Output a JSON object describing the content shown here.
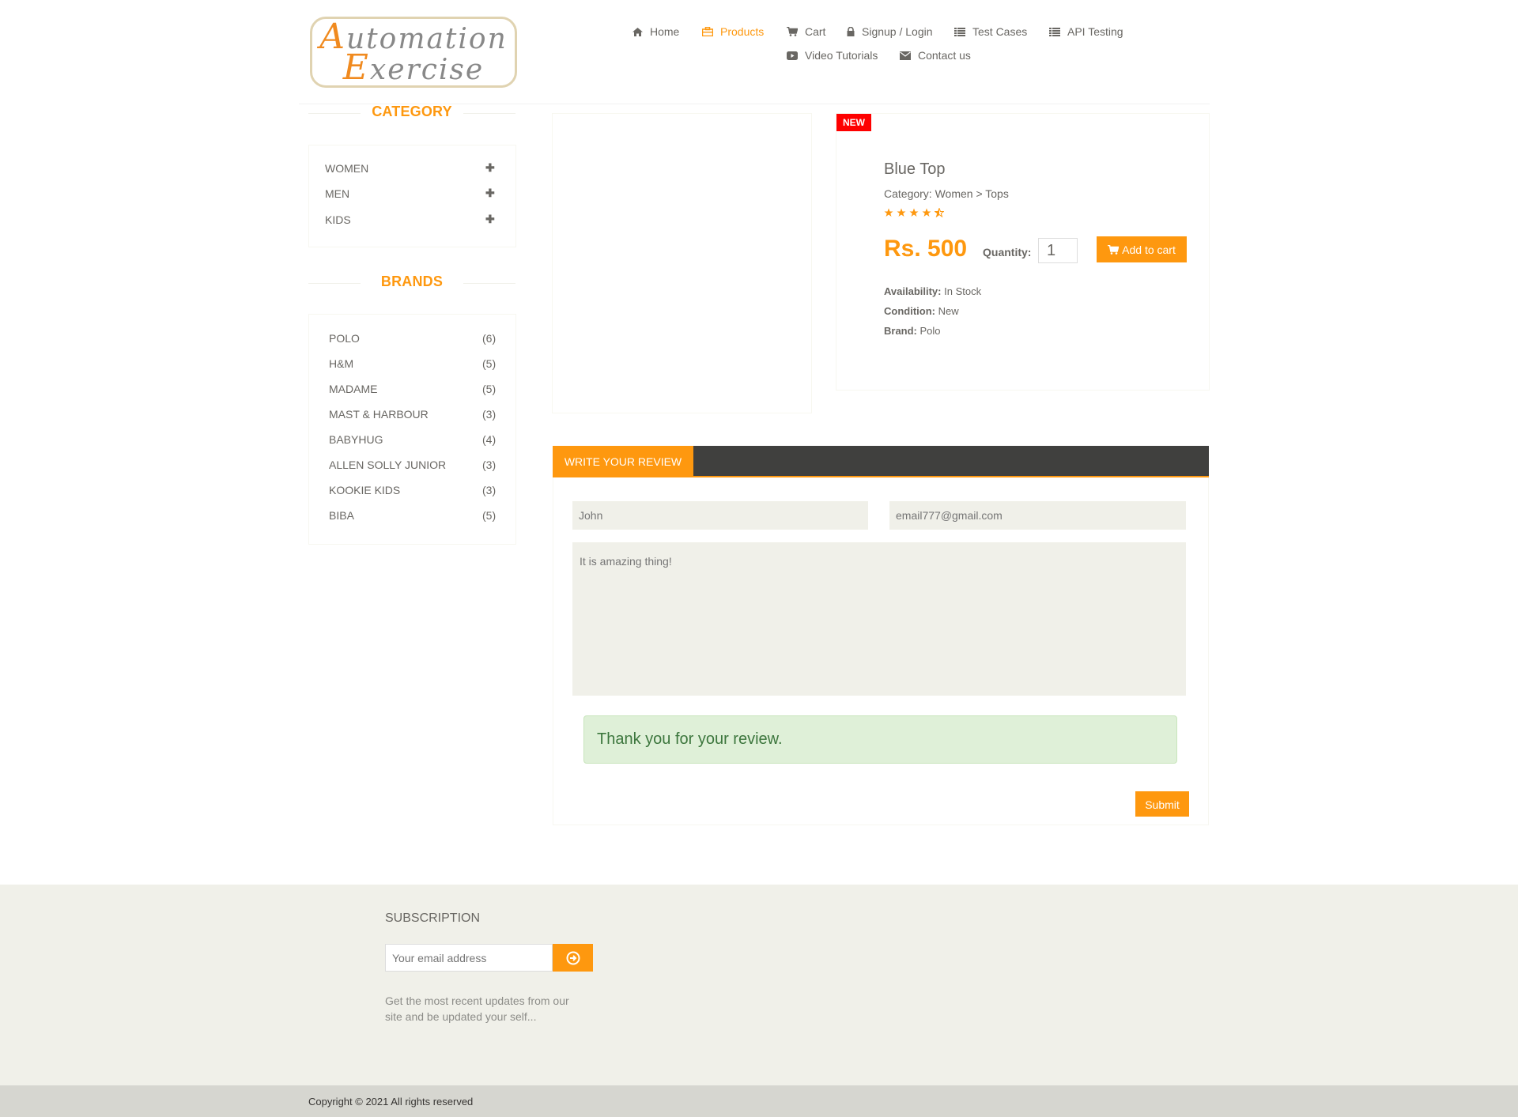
{
  "logo": {
    "line1_cap": "A",
    "line1_rest": "utomation",
    "line2_cap": "E",
    "line2_rest": "xercise"
  },
  "nav": [
    {
      "label": "Home",
      "icon": "home-icon",
      "active": false
    },
    {
      "label": "Products",
      "icon": "briefcase-icon",
      "active": true
    },
    {
      "label": "Cart",
      "icon": "cart-icon",
      "active": false
    },
    {
      "label": "Signup / Login",
      "icon": "lock-icon",
      "active": false
    },
    {
      "label": "Test Cases",
      "icon": "list-icon",
      "active": false
    },
    {
      "label": "API Testing",
      "icon": "list-icon",
      "active": false
    },
    {
      "label": "Video Tutorials",
      "icon": "youtube-play-icon",
      "active": false
    },
    {
      "label": "Contact us",
      "icon": "envelope-icon",
      "active": false
    }
  ],
  "sidebar": {
    "category_title": "CATEGORY",
    "categories": [
      "WOMEN",
      "MEN",
      "KIDS"
    ],
    "expand_symbol": "✚",
    "brands_title": "BRANDS",
    "brands": [
      {
        "name": "POLO",
        "count": "(6)"
      },
      {
        "name": "H&M",
        "count": "(5)"
      },
      {
        "name": "MADAME",
        "count": "(5)"
      },
      {
        "name": "MAST & HARBOUR",
        "count": "(3)"
      },
      {
        "name": "BABYHUG",
        "count": "(4)"
      },
      {
        "name": "ALLEN SOLLY JUNIOR",
        "count": "(3)"
      },
      {
        "name": "KOOKIE KIDS",
        "count": "(3)"
      },
      {
        "name": "BIBA",
        "count": "(5)"
      }
    ]
  },
  "product": {
    "badge": "NEW",
    "name": "Blue Top",
    "category": "Category: Women > Tops",
    "rating": 4.5,
    "price": "Rs. 500",
    "quantity_label": "Quantity:",
    "quantity_value": "1",
    "add_to_cart": "Add to cart",
    "availability_label": "Availability:",
    "availability_value": "In Stock",
    "condition_label": "Condition:",
    "condition_value": "New",
    "brand_label": "Brand:",
    "brand_value": "Polo"
  },
  "review": {
    "tab_label": "WRITE YOUR REVIEW",
    "name_placeholder": "John",
    "email_placeholder": "email777@gmail.com",
    "review_placeholder": "It is amazing thing!",
    "success_message": "Thank you for your review.",
    "submit_label": "Submit"
  },
  "footer": {
    "subscription_title": "SUBSCRIPTION",
    "email_placeholder": "Your email address",
    "description": "Get the most recent updates from our site and be updated your self...",
    "copyright": "Copyright © 2021 All rights reserved"
  },
  "colors": {
    "accent": "#fe980f",
    "badge": "#fe0000",
    "tab_bar": "#40403e",
    "success_bg": "#dff0d8",
    "success_text": "#3c763d",
    "footer_bg": "#f0f0e9"
  }
}
